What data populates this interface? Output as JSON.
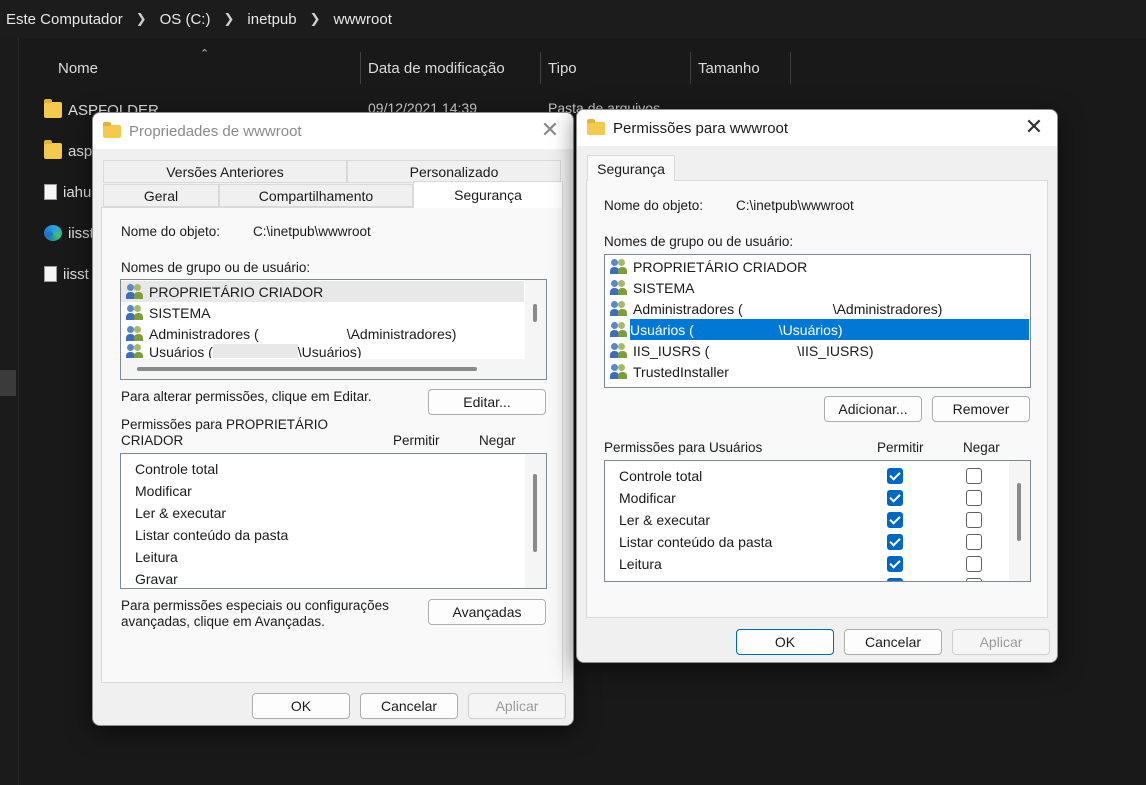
{
  "explorer": {
    "breadcrumb": [
      "Este Computador",
      "OS (C:)",
      "inetpub",
      "wwwroot"
    ],
    "columns": [
      "Nome",
      "Data de modificação",
      "Tipo",
      "Tamanho"
    ],
    "files": [
      {
        "name": "ASPFOLDER",
        "icon": "folder-icon"
      },
      {
        "name": "asp",
        "icon": "folder-icon"
      },
      {
        "name": "iahu",
        "icon": "document-icon"
      },
      {
        "name": "iisst",
        "icon": "edge-icon"
      },
      {
        "name": "iisst",
        "icon": "document-icon"
      }
    ],
    "first_row_date": "09/12/2021 14:39",
    "first_row_type": "Pasta de arquivos"
  },
  "props_dialog": {
    "title": "Propriedades de wwwroot",
    "tabs_row1": [
      "Versões Anteriores",
      "Personalizado"
    ],
    "tabs_row2": [
      "Geral",
      "Compartilhamento",
      "Segurança"
    ],
    "object_label": "Nome do objeto:",
    "object_value": "C:\\inetpub\\wwwroot",
    "groups_label": "Nomes de grupo ou de usuário:",
    "groups": [
      {
        "name": "PROPRIETÁRIO CRIADOR",
        "suffix": ""
      },
      {
        "name": "SISTEMA",
        "suffix": ""
      },
      {
        "name": "Administradores (",
        "suffix": "\\Administradores)"
      },
      {
        "name": "Usuários (",
        "suffix": "\\Usuários)"
      }
    ],
    "edit_hint": "Para alterar permissões, clique em Editar.",
    "edit_button": "Editar...",
    "perm_for_label": "Permissões para PROPRIETÁRIO CRIADOR",
    "allow_label": "Permitir",
    "deny_label": "Negar",
    "permissions": [
      "Controle total",
      "Modificar",
      "Ler & executar",
      "Listar conteúdo da pasta",
      "Leitura",
      "Gravar"
    ],
    "advanced_hint": "Para permissões especiais ou configurações avançadas, clique em Avançadas.",
    "advanced_button": "Avançadas",
    "ok": "OK",
    "cancel": "Cancelar",
    "apply": "Aplicar"
  },
  "perm_dialog": {
    "title": "Permissões para wwwroot",
    "tab": "Segurança",
    "object_label": "Nome do objeto:",
    "object_value": "C:\\inetpub\\wwwroot",
    "groups_label": "Nomes de grupo ou de usuário:",
    "groups": [
      {
        "name": "PROPRIETÁRIO CRIADOR",
        "suffix": ""
      },
      {
        "name": "SISTEMA",
        "suffix": ""
      },
      {
        "name": "Administradores (",
        "suffix": "\\Administradores)"
      },
      {
        "name": "Usuários (",
        "suffix": "\\Usuários)"
      },
      {
        "name": "IIS_IUSRS (",
        "suffix": "\\IIS_IUSRS)"
      },
      {
        "name": "TrustedInstaller",
        "suffix": ""
      }
    ],
    "selected_group_index": 3,
    "add_button": "Adicionar...",
    "remove_button": "Remover",
    "perm_for_label": "Permissões para Usuários",
    "allow_label": "Permitir",
    "deny_label": "Negar",
    "permissions": [
      {
        "name": "Controle total",
        "allow": true,
        "deny": false
      },
      {
        "name": "Modificar",
        "allow": true,
        "deny": false
      },
      {
        "name": "Ler & executar",
        "allow": true,
        "deny": false
      },
      {
        "name": "Listar conteúdo da pasta",
        "allow": true,
        "deny": false
      },
      {
        "name": "Leitura",
        "allow": true,
        "deny": false
      }
    ],
    "ok": "OK",
    "cancel": "Cancelar",
    "apply": "Aplicar"
  },
  "colors": {
    "selection": "#0078d4",
    "checkbox": "#0067c0",
    "dark_bg": "#191919"
  }
}
